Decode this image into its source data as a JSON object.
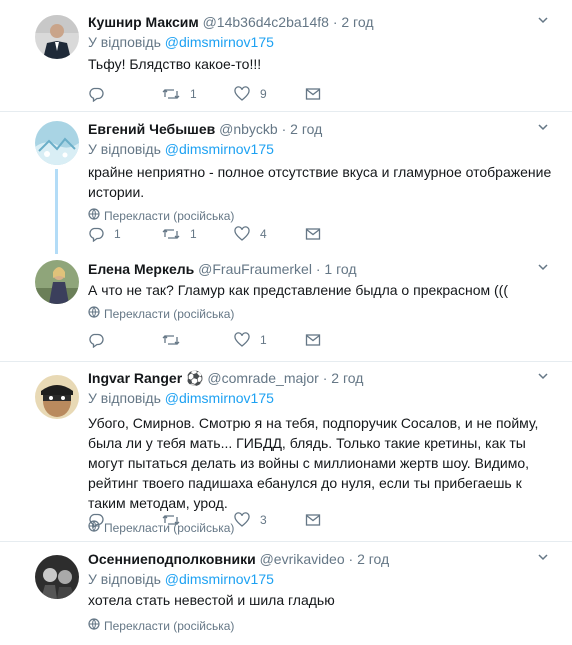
{
  "translate_label": "Перекласти (російська)",
  "reply_prefix": "У відповідь",
  "tweets": [
    {
      "name": "Кушнир Максим",
      "handle": "@14b36d4c2ba14f8",
      "time": "2 год",
      "reply_to": "@dimsmirnov175",
      "text": "Тьфу! Блядство какое-то!!!",
      "show_translate": false,
      "replies": "",
      "retweets": "1",
      "likes": "9"
    },
    {
      "name": "Евгений Чебышев",
      "handle": "@nbyckb",
      "time": "2 год",
      "reply_to": "@dimsmirnov175",
      "text": "крайне неприятно - полное отсутствие вкуса и гламурное отображение истории.",
      "show_translate": true,
      "replies": "1",
      "retweets": "1",
      "likes": "4"
    },
    {
      "name": "Елена Меркель",
      "handle": "@FrauFraumerkel",
      "time": "1 год",
      "text": "А что не так? Гламур как представление быдла о прекрасном (((",
      "show_translate": true,
      "replies": "",
      "retweets": "",
      "likes": "1"
    },
    {
      "name": "Ingvar Ranger",
      "emoji": "⚽",
      "handle": "@comrade_major",
      "time": "2 год",
      "reply_to": "@dimsmirnov175",
      "text": "Убого, Смирнов. Смотрю я на тебя, подпоручик Сосалов, и не пойму, была ли у тебя мать... ГИБДД, блядь. Только такие кретины, как ты могут пытаться делать из войны с миллионами жертв шоу. Видимо, рейтинг твоего падишаха ебанулся до нуля, если ты прибегаешь к таким методам, урод.",
      "show_translate": true,
      "replies": "",
      "retweets": "",
      "likes": "3"
    },
    {
      "name": "Осенниеподполковники",
      "handle": "@evrikavideo",
      "time": "2 год",
      "reply_to": "@dimsmirnov175",
      "text": "хотела стать невестой и шила гладью",
      "show_translate": true
    }
  ],
  "colors": {
    "link": "#1da1f2",
    "muted": "#657786",
    "thread": "#b3dcf7",
    "divider": "#e6ecf0"
  }
}
